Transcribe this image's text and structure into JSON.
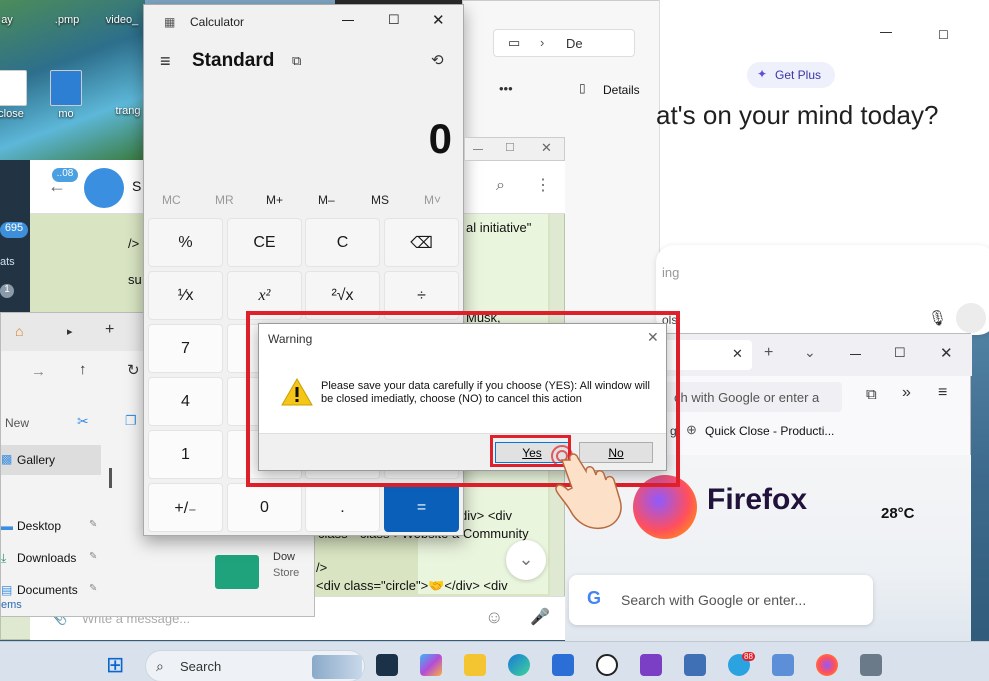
{
  "desktop": {
    "icons": [
      {
        "label": "ay"
      },
      {
        "label": ".pmp"
      },
      {
        "label": "video_"
      },
      {
        "label": "close"
      },
      {
        "label": "mo"
      },
      {
        "label": "trang"
      }
    ],
    "top_right_fragment": "Desktop"
  },
  "calculator": {
    "title": "Calculator",
    "mode": "Standard",
    "display": "0",
    "memory": [
      "MC",
      "MR",
      "M+",
      "M–",
      "MS",
      "M˅"
    ],
    "keys": [
      [
        "%",
        "CE",
        "C",
        "⌫"
      ],
      [
        "¹⁄x",
        "x²",
        "²√x",
        "÷"
      ],
      [
        "7",
        "",
        "",
        ""
      ],
      [
        "4",
        "",
        "",
        ""
      ],
      [
        "1",
        "",
        "",
        ""
      ],
      [
        "+/₋",
        "0",
        ".",
        "="
      ]
    ]
  },
  "explorer_top": {
    "path_item": "De",
    "more": "•••",
    "details": "Details"
  },
  "chat": {
    "badge_top": "..08",
    "badge_unread": "695",
    "chats_label": "ats",
    "count": "1",
    "title_fragment": "S",
    "lines": [
      "/>",
      "su",
      "al initiative\"",
      "Musk,",
      "div> <div",
      "class=\"class\">Website a Community",
      "/>",
      "<div class=\"circle\">🤝</div> <div"
    ],
    "message_placeholder": "Write a message..."
  },
  "explorer_bottom": {
    "new_label": "New",
    "nav": [
      {
        "label": "Gallery"
      },
      {
        "label": "Desktop"
      },
      {
        "label": "Downloads"
      },
      {
        "label": "Documents"
      }
    ],
    "items_label": "ems",
    "download_label_1": "Dow",
    "download_label_2": "Store"
  },
  "chatgpt": {
    "get_plus": "Get Plus",
    "headline": "at's on your mind today?",
    "input_placeholder": "ing",
    "tools_fragment": "ols"
  },
  "firefox": {
    "address_placeholder": "ch with Google or enter a",
    "bookmark": "Quick Close - Producti...",
    "bookmark_prefix": "g",
    "brand": "Firefox",
    "weather": "28°C",
    "search_placeholder": "Search with Google or enter..."
  },
  "dialog": {
    "title": "Warning",
    "message": "Please save your data carefully if you choose (YES): All window will be closed imediatly, choose (NO) to cancel this action",
    "yes": "Yes",
    "no": "No"
  },
  "taskbar": {
    "search": "Search",
    "telegram_badge": "88"
  }
}
